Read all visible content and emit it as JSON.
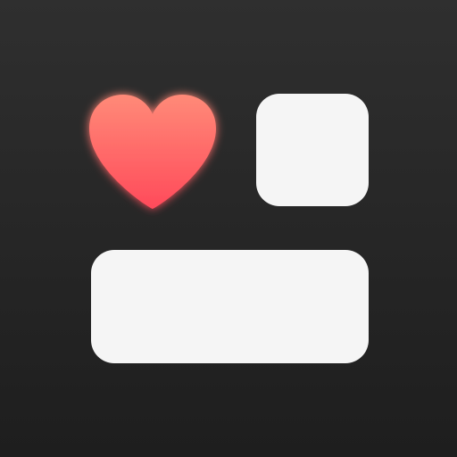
{
  "icon": {
    "name": "widget-app-icon",
    "heart_icon": "heart-icon",
    "colors": {
      "background_top": "#2f2f2f",
      "background_bottom": "#1e1e1e",
      "heart_top": "#ff8a78",
      "heart_bottom": "#ff4a5a",
      "tile": "#f5f5f5"
    }
  }
}
